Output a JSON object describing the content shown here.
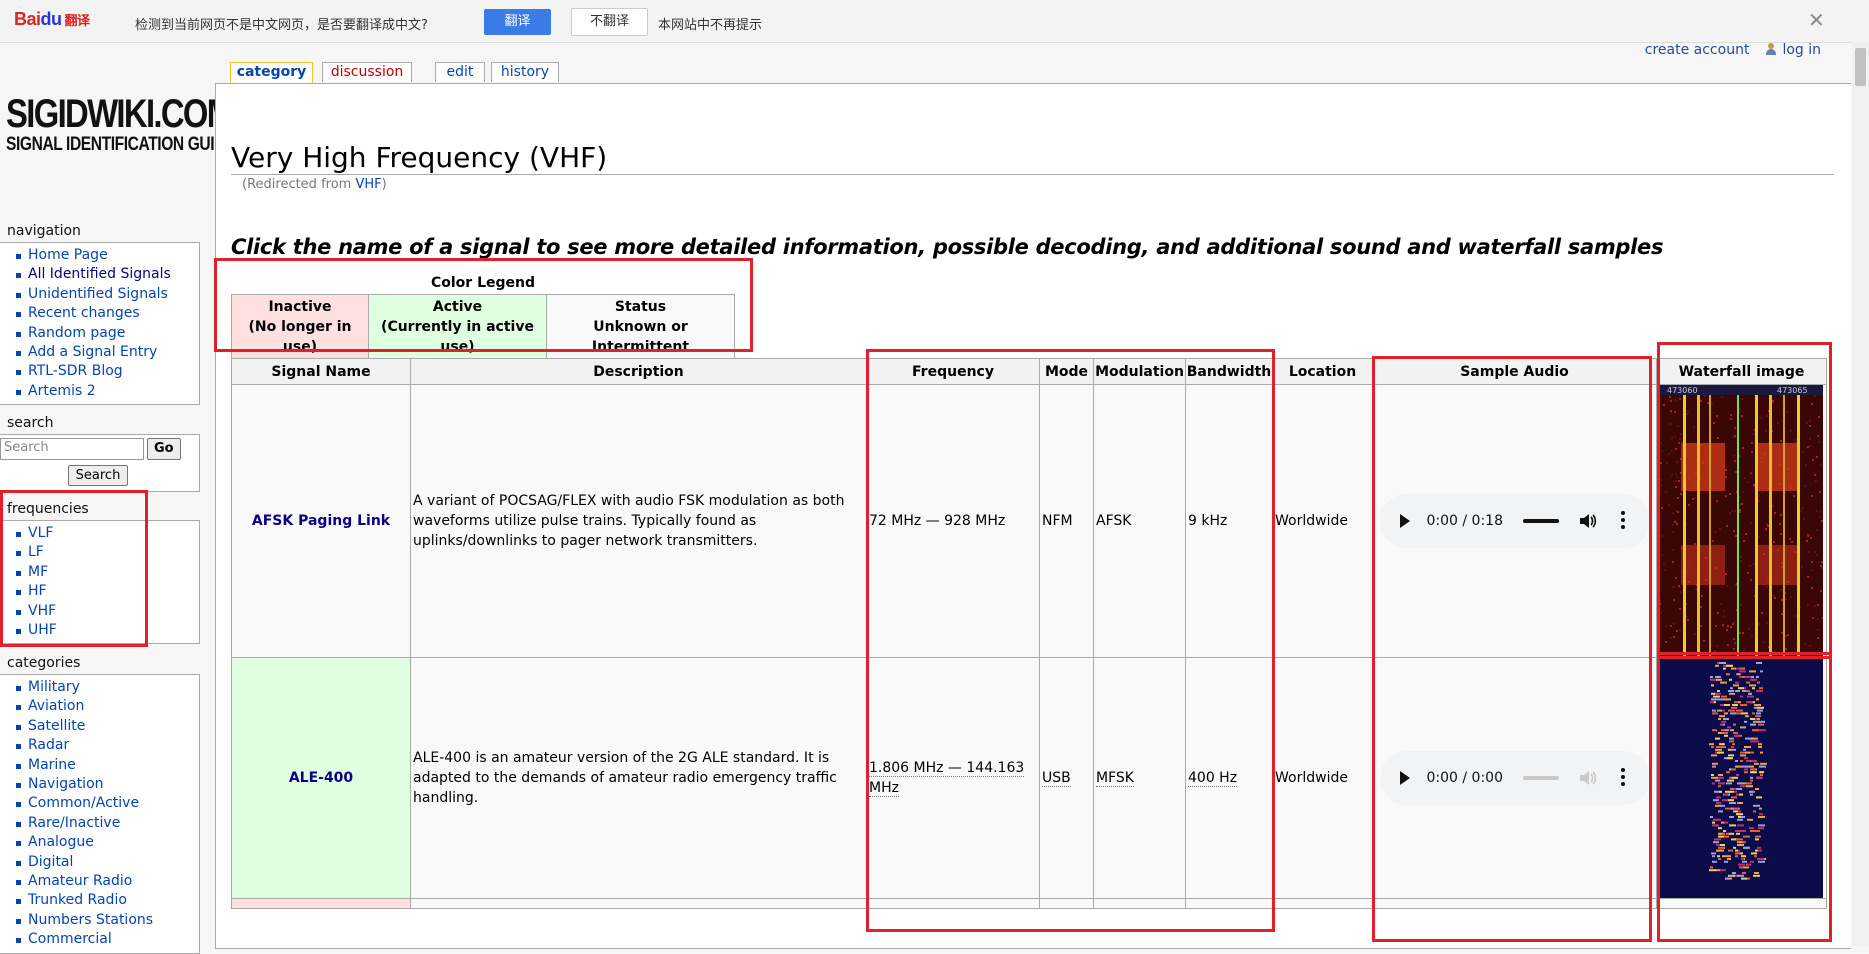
{
  "translate_bar": {
    "logo_text": "Bai",
    "logo_paw": "du",
    "logo_fy": "翻译",
    "message": "检测到当前网页不是中文网页，是否要翻译成中文?",
    "translate_button": "翻译",
    "no_translate_button": "不翻译",
    "never_label": "本网站中不再提示",
    "close_glyph": "✕"
  },
  "personal": {
    "create_account": "create account",
    "log_in": "log in"
  },
  "logo": {
    "line1": "SIGIDWIKI.COM",
    "line2": "SIGNAL IDENTIFICATION GUIDE"
  },
  "tabs": [
    {
      "label": "category"
    },
    {
      "label": "discussion"
    },
    {
      "label": "edit"
    },
    {
      "label": "history"
    }
  ],
  "navigation": {
    "title": "navigation",
    "items": [
      "Home Page",
      "All Identified Signals",
      "Unidentified Signals",
      "Recent changes",
      "Random page",
      "Add a Signal Entry",
      "RTL-SDR Blog",
      "Artemis 2"
    ]
  },
  "search": {
    "title": "search",
    "placeholder": "Search",
    "go_label": "Go",
    "search_label": "Search"
  },
  "frequencies": {
    "title": "frequencies",
    "items": [
      "VLF",
      "LF",
      "MF",
      "HF",
      "VHF",
      "UHF"
    ]
  },
  "categories": {
    "title": "categories",
    "items": [
      "Military",
      "Aviation",
      "Satellite",
      "Radar",
      "Marine",
      "Navigation",
      "Common/Active",
      "Rare/Inactive",
      "Analogue",
      "Digital",
      "Amateur Radio",
      "Trunked Radio",
      "Numbers Stations",
      "Commercial"
    ]
  },
  "page": {
    "title": "Very High Frequency (VHF)",
    "redirect_prefix": "(Redirected from ",
    "redirect_link": "VHF",
    "redirect_suffix": ")",
    "intro": "Click the name of a signal to see more detailed information, possible decoding, and additional sound and waterfall samples"
  },
  "legend": {
    "caption": "Color Legend",
    "inactive_l1": "Inactive",
    "inactive_l2": "(No longer in use)",
    "active_l1": "Active",
    "active_l2": "(Currently in active use)",
    "status_l1": "Status",
    "status_l2": "Unknown or Intermittent",
    "colors": {
      "inactive": "#ffe0e0",
      "active": "#e0ffe0",
      "status": "#f9f9f9"
    }
  },
  "table": {
    "headers": [
      "Signal Name",
      "Description",
      "Frequency",
      "Mode",
      "Modulation",
      "Bandwidth",
      "Location",
      "Sample Audio",
      "Waterfall image"
    ],
    "rows": [
      {
        "name": "AFSK Paging Link",
        "description": "A variant of POCSAG/FLEX with audio FSK modulation as both waveforms utilize pulse trains. Typically found as uplinks/downlinks to pager network transmitters.",
        "frequency": "72 MHz — 928 MHz",
        "mode": "NFM",
        "modulation": "AFSK",
        "bandwidth": "9 kHz",
        "location": "Worldwide",
        "audio_time": "0:00 / 0:18",
        "waterfall_ticks": [
          "473060",
          "473065"
        ]
      },
      {
        "name": "ALE-400",
        "description": "ALE-400 is an amateur version of the 2G ALE standard. It is adapted to the demands of amateur radio emergency traffic handling.",
        "frequency": "1.806 MHz — 144.163 MHz",
        "mode": "USB",
        "modulation": "MFSK",
        "bandwidth": "400 Hz",
        "location": "Worldwide",
        "audio_time": "0:00 / 0:00"
      }
    ]
  }
}
